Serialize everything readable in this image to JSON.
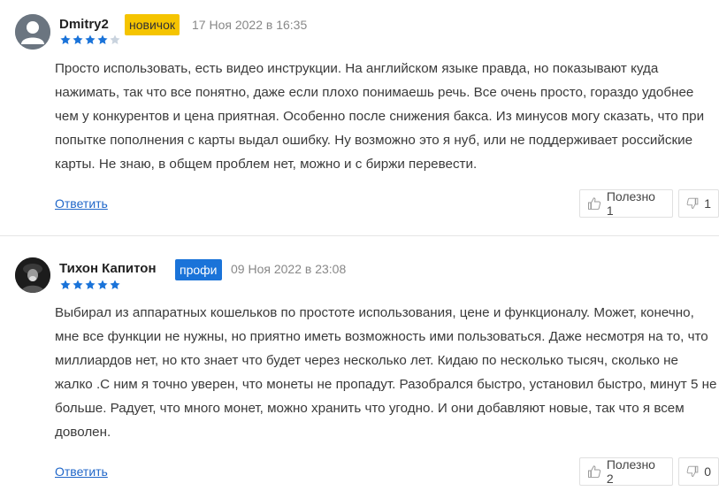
{
  "reviews": [
    {
      "username": "Dmitry2",
      "badge": "новичок",
      "date": "17 Ноя 2022 в 16:35",
      "rating": 4,
      "text": "Просто использовать, есть видео инструкции. На английском языке правда, но показывают куда нажимать, так что все понятно, даже если плохо понимаешь речь. Все очень просто, гораздо удобнее чем у конкурентов и цена приятная. Особенно после снижения бакса. Из минусов могу сказать, что при попытке пополнения с карты выдал ошибку. Ну возможно это я нуб, или не поддерживает российские карты. Не знаю, в общем проблем нет, можно и с биржи перевести.",
      "reply_label": "Ответить",
      "helpful_label": "Полезно 1",
      "unhelpful_count": "1"
    },
    {
      "username": "Тихон Капитон",
      "badge": "профи",
      "date": "09 Ноя 2022 в 23:08",
      "rating": 5,
      "text": "Выбирал из аппаратных кошельков по простоте использования, цене и функционалу. Может, конечно, мне все функции не нужны, но приятно иметь возможность ими пользоваться. Даже несмотря на то, что миллиардов нет, но кто знает что будет через несколько лет. Кидаю по несколько тысяч, сколько не жалко .С ним я точно уверен, что монеты не пропадут. Разобрался быстро, установил быстро, минут 5 не больше. Радует, что много монет, можно хранить что угодно. И они добавляют новые, так что я всем доволен.",
      "reply_label": "Ответить",
      "helpful_label": "Полезно 2",
      "unhelpful_count": "0"
    }
  ],
  "colors": {
    "star_filled": "#1a73d9",
    "star_empty": "#c9d3de",
    "badge_novice": "#f5c400",
    "badge_pro": "#1a73d9",
    "link": "#2067c9"
  },
  "icons": {
    "avatar_default": "user-silhouette-icon",
    "thumb_up": "thumbs-up-icon",
    "thumb_down": "thumbs-down-icon",
    "star": "star-icon"
  }
}
